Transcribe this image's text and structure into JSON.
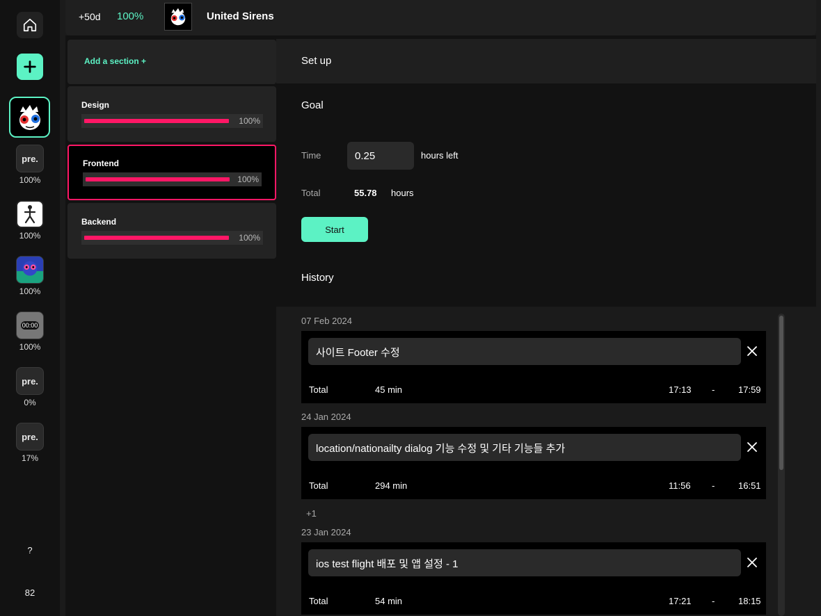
{
  "rail": {
    "projects": [
      {
        "label": "pre.",
        "pct": "100%"
      },
      {
        "label": "",
        "pct": "100%"
      },
      {
        "label": "",
        "pct": "100%"
      },
      {
        "label": "00:00",
        "pct": "100%"
      },
      {
        "label": "pre.",
        "pct": "0%"
      },
      {
        "label": "pre.",
        "pct": "17%"
      }
    ],
    "help": "?",
    "count": "82"
  },
  "topbar": {
    "days": "+50d",
    "pct": "100%",
    "title": "United Sirens"
  },
  "sections": {
    "add_label": "Add a section +",
    "items": [
      {
        "name": "Design",
        "pct": "100%",
        "progress": 1.0
      },
      {
        "name": "Frontend",
        "pct": "100%",
        "progress": 1.0
      },
      {
        "name": "Backend",
        "pct": "100%",
        "progress": 1.0
      }
    ]
  },
  "main": {
    "setup": "Set up",
    "goal": "Goal",
    "time_label": "Time",
    "time_value": "0.25",
    "hours_left": "hours left",
    "total_label": "Total",
    "total_value": "55.78",
    "total_unit": "hours",
    "start": "Start",
    "history": "History"
  },
  "history": {
    "dates": [
      "07 Feb 2024",
      "24 Jan 2024",
      "23 Jan 2024"
    ],
    "more": "+1",
    "entries": [
      {
        "title": "사이트 Footer 수정",
        "total": "Total",
        "minutes": "45 min",
        "start": "17:13",
        "dash": "-",
        "end": "17:59"
      },
      {
        "title": "location/nationailty dialog 기능 수정 및 기타 기능들 추가",
        "total": "Total",
        "minutes": "294 min",
        "start": "11:56",
        "dash": "-",
        "end": "16:51"
      },
      {
        "title": "ios test flight 배포 및 앱 설정 - 1",
        "total": "Total",
        "minutes": "54 min",
        "start": "17:21",
        "dash": "-",
        "end": "18:15"
      }
    ]
  },
  "colors": {
    "accent": "#5cf2c4",
    "progress": "#ff1766",
    "active_border": "#ff1766"
  }
}
